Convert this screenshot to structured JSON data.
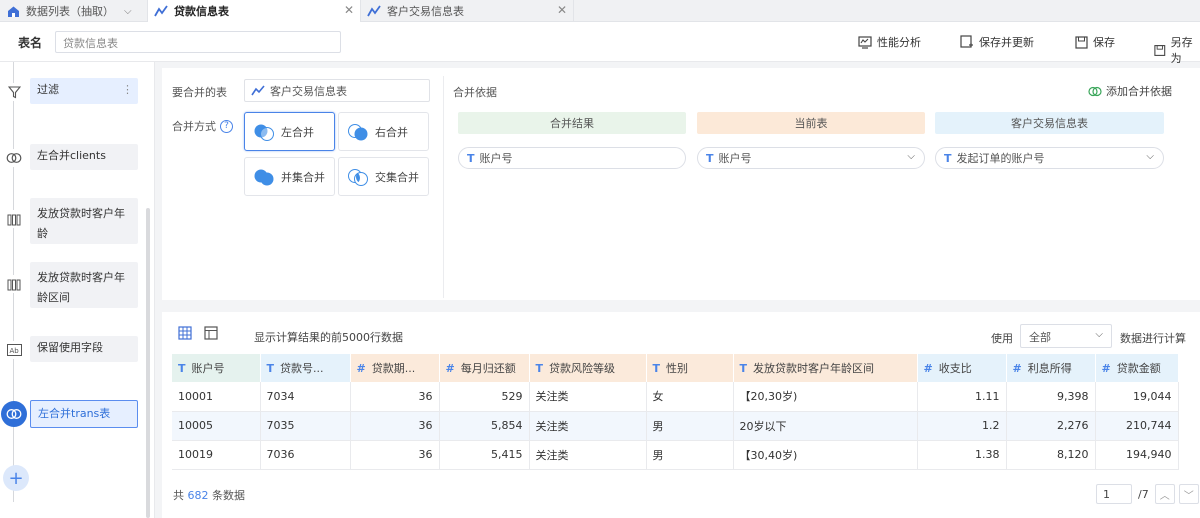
{
  "tabs": [
    {
      "label": "数据列表（抽取）",
      "icon": "home-icon"
    },
    {
      "label": "贷款信息表",
      "icon": "chart-line-icon"
    },
    {
      "label": "客户交易信息表",
      "icon": "chart-line-icon"
    }
  ],
  "header": {
    "name_label": "表名",
    "name_value": "贷款信息表",
    "actions": [
      "性能分析",
      "保存并更新",
      "保存",
      "另存为"
    ]
  },
  "sidebar": {
    "nodes": [
      {
        "label": "过滤",
        "icon": "filter-icon"
      },
      {
        "label": "左合并clients",
        "icon": "join-icon"
      },
      {
        "label": "发放贷款时客户年龄",
        "icon": "bar-columns-icon"
      },
      {
        "label": "发放贷款时客户年龄区间",
        "icon": "bar-columns-icon"
      },
      {
        "label": "保留使用字段",
        "icon": "ab-field-icon"
      },
      {
        "label": "左合并trans表",
        "icon": "join-icon"
      }
    ],
    "add_label": "+"
  },
  "config": {
    "merge_table_label": "要合并的表",
    "merge_table_value": "客户交易信息表",
    "method_label": "合并方式",
    "help_label": "?",
    "methods": [
      "左合并",
      "右合并",
      "并集合并",
      "交集合并"
    ],
    "selected_method": "左合并",
    "basis_title": "合并依据",
    "add_basis": "添加合并依据",
    "basis_columns": [
      "合并结果",
      "当前表",
      "客户交易信息表"
    ],
    "basis_fields": [
      "账户号",
      "账户号",
      "发起订单的账户号"
    ],
    "colors": {
      "result": "#e9f4ea",
      "current": "#fce9d8",
      "other": "#e4f2fb"
    }
  },
  "results": {
    "info": "显示计算结果的前5000行数据",
    "use_label": "使用",
    "use_value": "全部",
    "calc_label": "数据进行计算",
    "columns": [
      {
        "type": "T",
        "label": "账户号"
      },
      {
        "type": "T",
        "label": "贷款号..."
      },
      {
        "type": "#",
        "label": "贷款期..."
      },
      {
        "type": "#",
        "label": "每月归还额"
      },
      {
        "type": "T",
        "label": "贷款风险等级"
      },
      {
        "type": "T",
        "label": "性别"
      },
      {
        "type": "T",
        "label": "发放贷款时客户年龄区间"
      },
      {
        "type": "#",
        "label": "收支比"
      },
      {
        "type": "#",
        "label": "利息所得"
      },
      {
        "type": "#",
        "label": "贷款金额"
      }
    ],
    "rows": [
      [
        "10001",
        "7034",
        "36",
        "529",
        "关注类",
        "女",
        "【20,30岁)",
        "1.11",
        "9,398",
        "19,044"
      ],
      [
        "10005",
        "7035",
        "36",
        "5,854",
        "关注类",
        "男",
        "20岁以下",
        "1.2",
        "2,276",
        "210,744"
      ],
      [
        "10019",
        "7036",
        "36",
        "5,415",
        "关注类",
        "男",
        "【30,40岁)",
        "1.38",
        "8,120",
        "194,940"
      ]
    ],
    "total_prefix": "共",
    "total_count": "682",
    "total_suffix": "条数据",
    "page": "1",
    "page_total": "/7"
  }
}
